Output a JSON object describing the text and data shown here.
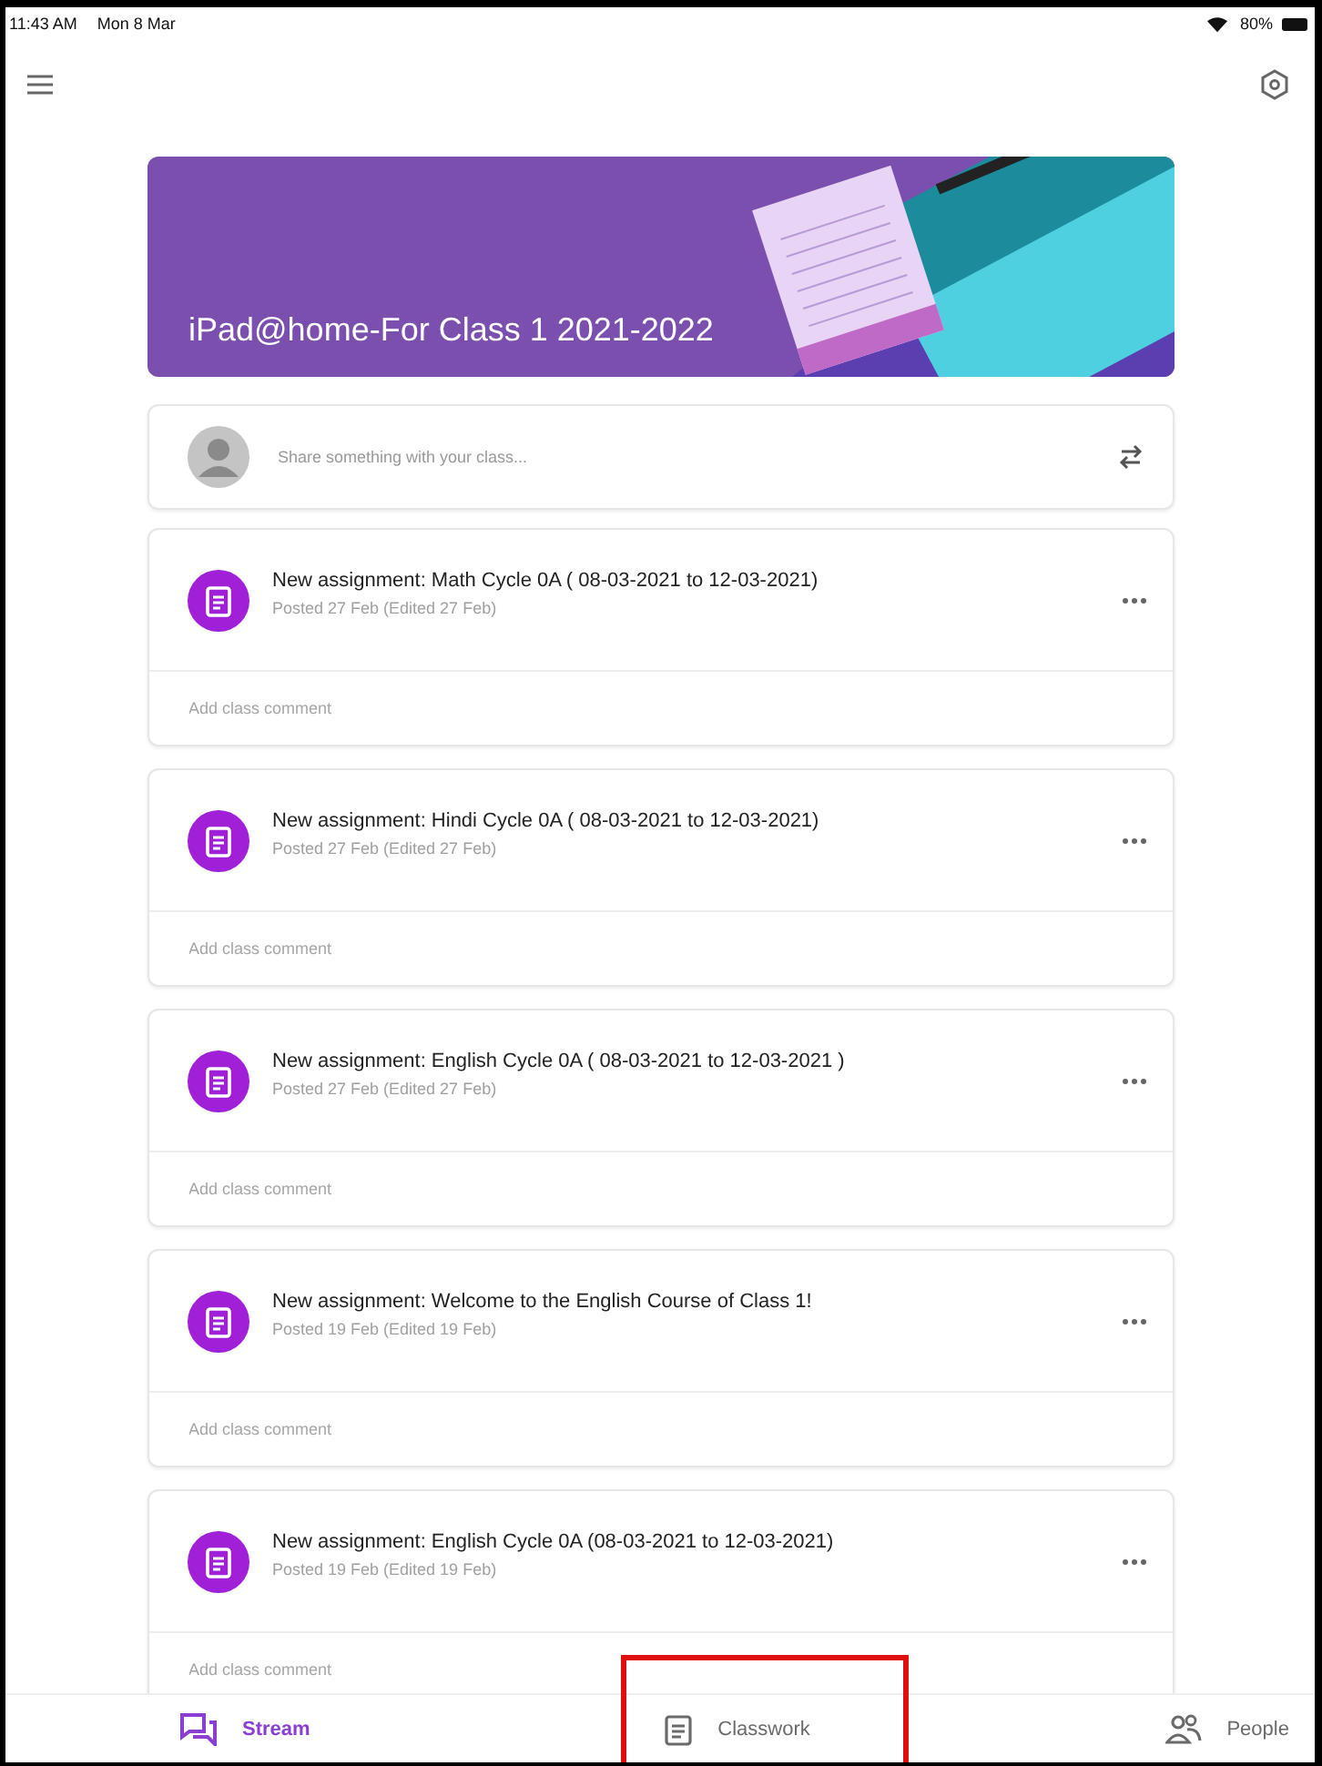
{
  "status_bar": {
    "time": "11:43 AM",
    "date": "Mon 8 Mar",
    "battery": "80%"
  },
  "banner": {
    "title": "iPad@home-For Class 1 2021-2022"
  },
  "share": {
    "placeholder": "Share something with your class..."
  },
  "posts": [
    {
      "title": "New assignment: Math Cycle 0A ( 08-03-2021 to 12-03-2021)",
      "meta": "Posted 27 Feb (Edited 27 Feb)",
      "comment_placeholder": "Add class comment"
    },
    {
      "title": "New assignment: Hindi Cycle 0A ( 08-03-2021 to 12-03-2021)",
      "meta": "Posted 27 Feb (Edited 27 Feb)",
      "comment_placeholder": "Add class comment"
    },
    {
      "title": "New assignment: English Cycle 0A ( 08-03-2021 to 12-03-2021 )",
      "meta": "Posted 27 Feb (Edited 27 Feb)",
      "comment_placeholder": "Add class comment"
    },
    {
      "title": "New assignment: Welcome to the English Course of Class 1!",
      "meta": "Posted 19 Feb (Edited 19 Feb)",
      "comment_placeholder": "Add class comment"
    },
    {
      "title": "New assignment: English Cycle 0A (08-03-2021 to 12-03-2021)",
      "meta": "Posted 19 Feb (Edited 19 Feb)",
      "comment_placeholder": "Add class comment"
    }
  ],
  "bottom_nav": [
    {
      "label": "Stream",
      "kind": "stream",
      "selected": true,
      "highlighted": false
    },
    {
      "label": "Classwork",
      "kind": "classwork",
      "selected": false,
      "highlighted": true
    },
    {
      "label": "People",
      "kind": "people",
      "selected": false,
      "highlighted": false
    }
  ]
}
